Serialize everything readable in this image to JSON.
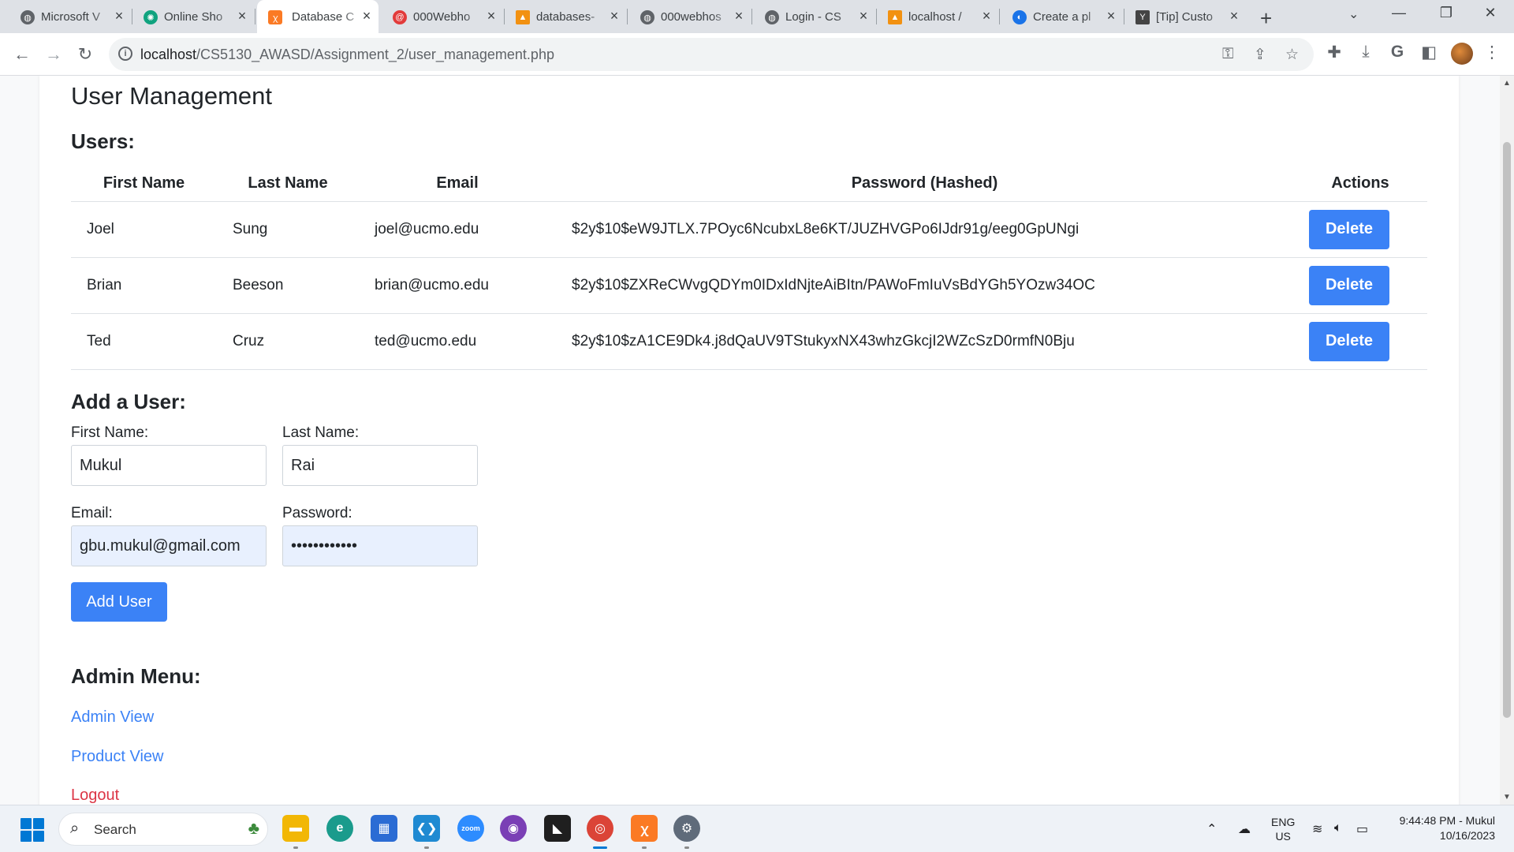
{
  "browser": {
    "tabs": [
      {
        "title": "Microsoft V",
        "favicon": "globe-icon",
        "color": "#5f6368"
      },
      {
        "title": "Online Sho",
        "favicon": "chatgpt-icon",
        "color": "#10a37f"
      },
      {
        "title": "Database C",
        "favicon": "xampp-icon",
        "color": "#fb7a24",
        "active": true
      },
      {
        "title": "000Webho",
        "favicon": "000webhost-icon",
        "color": "#e23b3b"
      },
      {
        "title": "databases-",
        "favicon": "phpmyadmin-icon",
        "color": "#f29111"
      },
      {
        "title": "000webhos",
        "favicon": "globe-icon",
        "color": "#5f6368"
      },
      {
        "title": "Login - CS",
        "favicon": "globe-icon",
        "color": "#5f6368"
      },
      {
        "title": "localhost /",
        "favicon": "phpmyadmin-icon",
        "color": "#f29111"
      },
      {
        "title": "Create a pl",
        "favicon": "edge-icon",
        "color": "#1a73e8"
      },
      {
        "title": "[Tip] Custo",
        "favicon": "y-icon",
        "color": "#444444"
      }
    ],
    "url_host": "localhost",
    "url_path": "/CS5130_AWASD/Assignment_2/user_management.php"
  },
  "page": {
    "title": "User Management",
    "users_heading": "Users:",
    "table": {
      "headers": [
        "First Name",
        "Last Name",
        "Email",
        "Password (Hashed)",
        "Actions"
      ],
      "rows": [
        {
          "first": "Joel",
          "last": "Sung",
          "email": "joel@ucmo.edu",
          "password": "$2y$10$eW9JTLX.7POyc6NcubxL8e6KT/JUZHVGPo6IJdr91g/eeg0GpUNgi",
          "action": "Delete"
        },
        {
          "first": "Brian",
          "last": "Beeson",
          "email": "brian@ucmo.edu",
          "password": "$2y$10$ZXReCWvgQDYm0IDxIdNjteAiBItn/PAWoFmIuVsBdYGh5YOzw34OC",
          "action": "Delete"
        },
        {
          "first": "Ted",
          "last": "Cruz",
          "email": "ted@ucmo.edu",
          "password": "$2y$10$zA1CE9Dk4.j8dQaUV9TStukyxNX43whzGkcjI2WZcSzD0rmfN0Bju",
          "action": "Delete"
        }
      ]
    },
    "add_heading": "Add a User:",
    "form": {
      "first_label": "First Name:",
      "first_value": "Mukul",
      "last_label": "Last Name:",
      "last_value": "Rai",
      "email_label": "Email:",
      "email_value": "gbu.mukul@gmail.com",
      "password_label": "Password:",
      "password_value": "••••••••••••",
      "submit": "Add User"
    },
    "admin_heading": "Admin Menu:",
    "links": {
      "admin_view": "Admin View",
      "product_view": "Product View",
      "logout": "Logout"
    }
  },
  "taskbar": {
    "search_placeholder": "Search",
    "lang_1": "ENG",
    "lang_2": "US",
    "time": "9:44:48 PM - Mukul",
    "date": "10/16/2023"
  },
  "colors": {
    "accent": "#3b82f6",
    "logout": "#dc3545",
    "autofill": "#e8f0fe"
  }
}
